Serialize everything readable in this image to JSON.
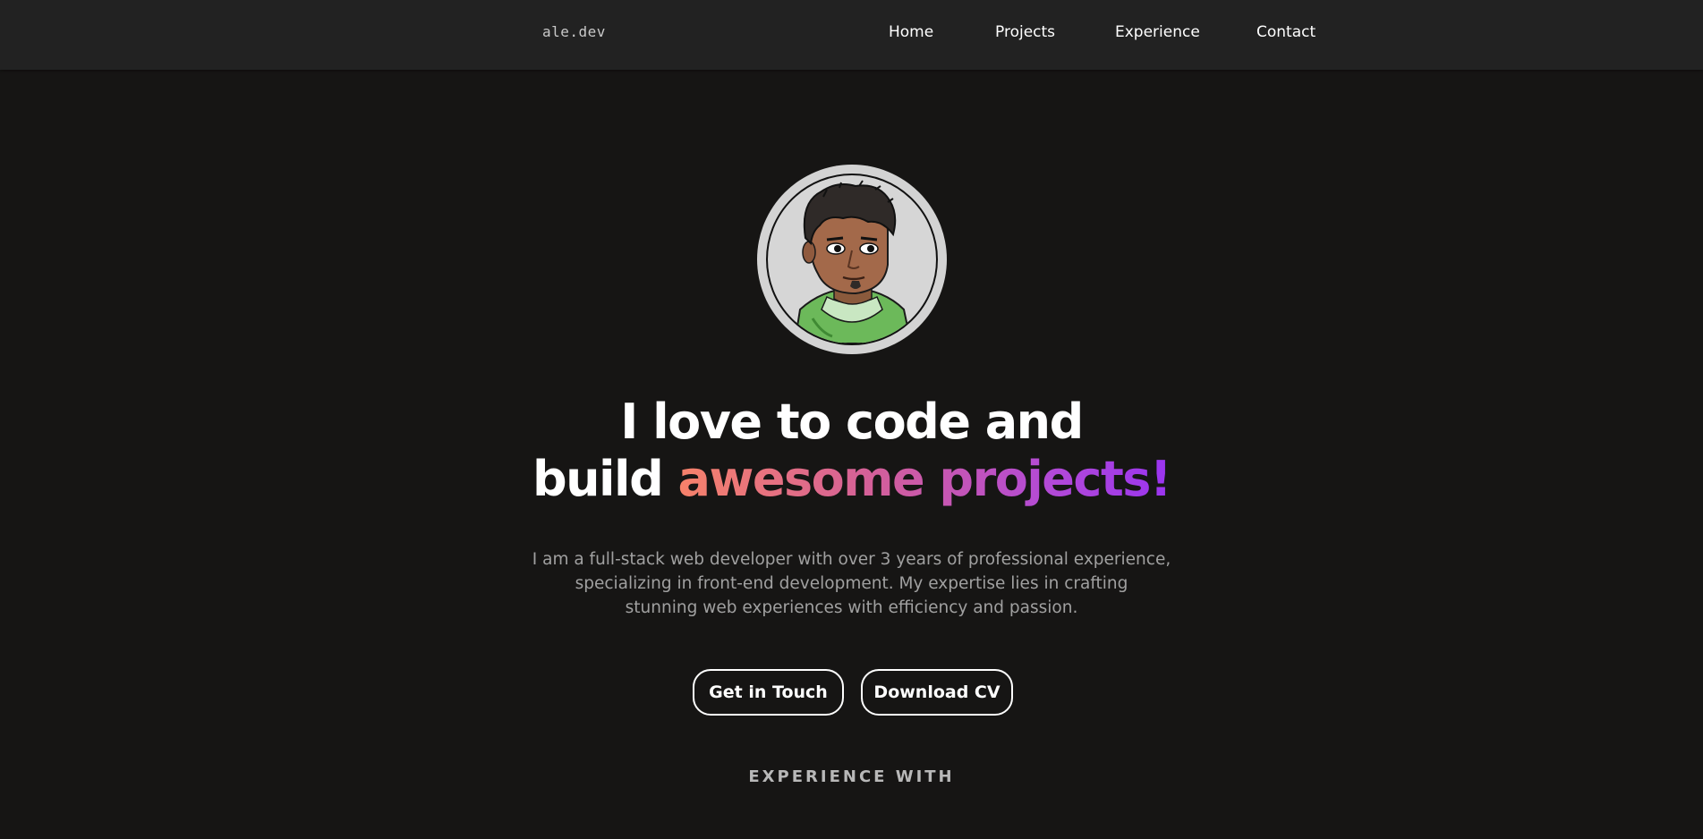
{
  "navbar": {
    "brand": "ale.dev",
    "links": [
      {
        "label": "Home"
      },
      {
        "label": "Projects"
      },
      {
        "label": "Experience"
      },
      {
        "label": "Contact"
      }
    ]
  },
  "hero": {
    "avatar_icon": "pixel-art-developer-avatar",
    "headline_line1": "I love to code and",
    "headline_line2_plain": "build ",
    "headline_line2_highlight": "awesome projects!",
    "intro_lines": [
      "I am a full-stack web developer with over 3 years of professional experience,",
      "specializing in front-end development. My expertise lies in crafting",
      "stunning web experiences with efficiency and passion."
    ],
    "buttons": {
      "contact": "Get in Touch",
      "cv": "Download CV"
    },
    "experience_heading": "EXPERIENCE WITH"
  },
  "colors": {
    "background": "#161514",
    "navbar": "#222222",
    "gradient_start": "#f7826a",
    "gradient_end": "#9a34f0"
  }
}
